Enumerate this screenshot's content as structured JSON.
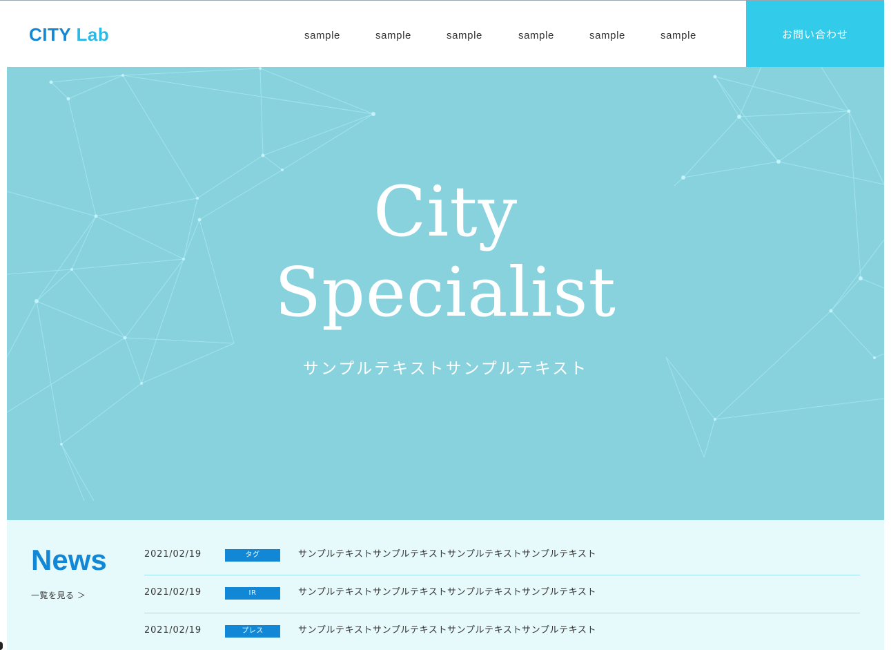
{
  "header": {
    "logo_city": "CITY",
    "logo_lab": "Lab",
    "nav": [
      "sample",
      "sample",
      "sample",
      "sample",
      "sample",
      "sample"
    ],
    "contact_label": "お問い合わせ"
  },
  "hero": {
    "title_line1": "City",
    "title_line2": "Specialist",
    "subtitle": "サンプルテキストサンプルテキスト"
  },
  "news": {
    "title": "News",
    "more_link": "一覧を見る ＞",
    "items": [
      {
        "date": "2021/02/19",
        "tag": "タグ",
        "text": "サンプルテキストサンプルテキストサンプルテキストサンプルテキスト"
      },
      {
        "date": "2021/02/19",
        "tag": "IR",
        "text": "サンプルテキストサンプルテキストサンプルテキストサンプルテキスト"
      },
      {
        "date": "2021/02/19",
        "tag": "プレス",
        "text": "サンプルテキストサンプルテキストサンプルテキストサンプルテキスト"
      }
    ]
  },
  "colors": {
    "brand_blue": "#1187d6",
    "accent_cyan": "#33cbea",
    "hero_bg": "#88d2de",
    "news_bg": "#e6fafc"
  }
}
